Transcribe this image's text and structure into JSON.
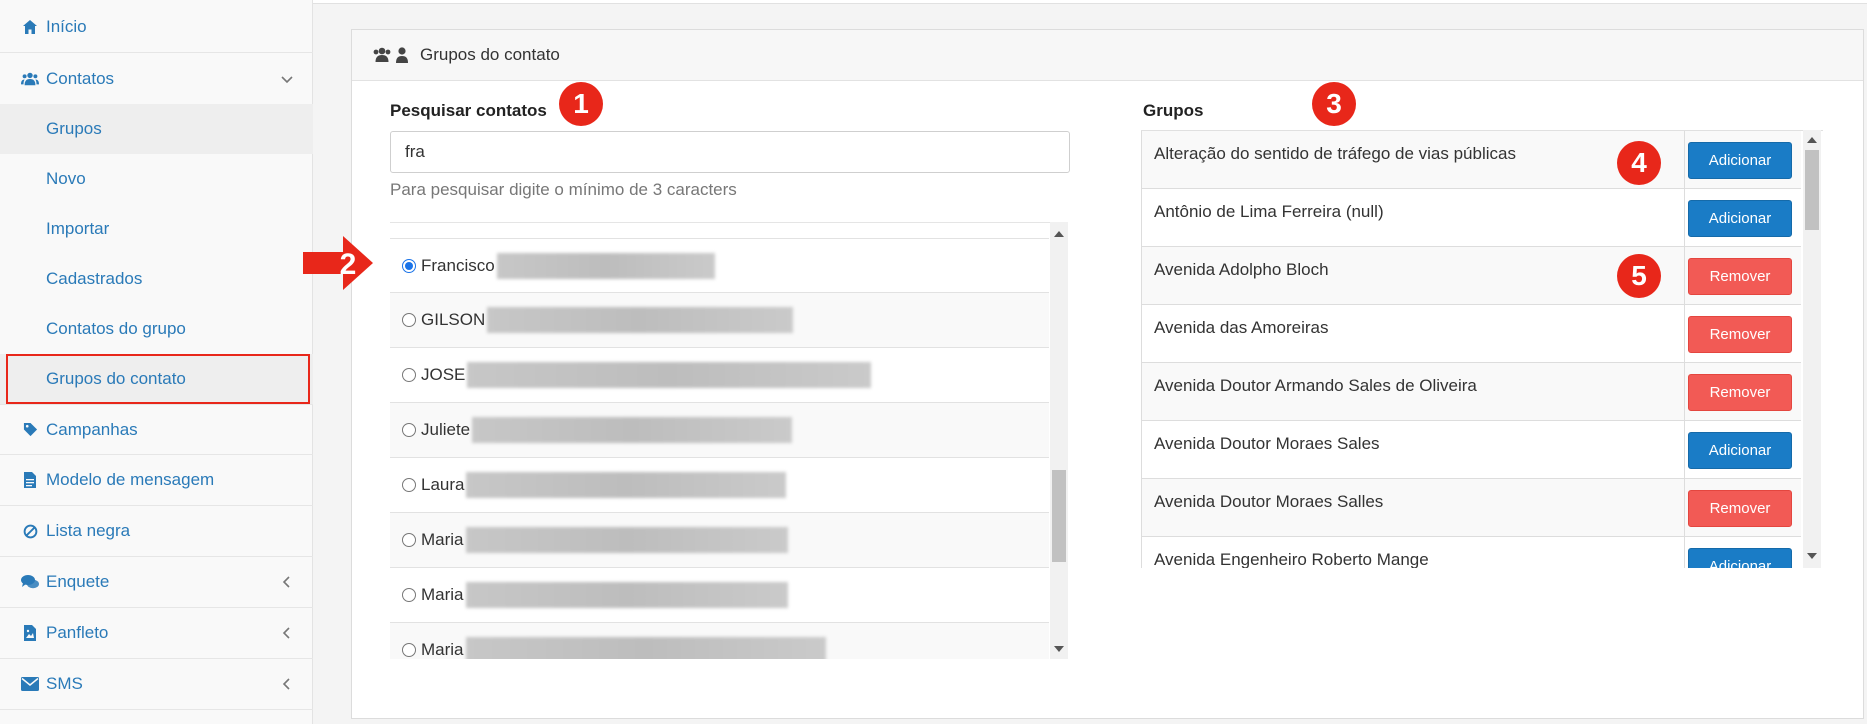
{
  "sidebar": {
    "items": [
      {
        "label": "Início",
        "icon": "home-icon"
      },
      {
        "label": "Contatos",
        "icon": "users-icon"
      },
      {
        "label": "Campanhas",
        "icon": "tag-icon"
      },
      {
        "label": "Modelo de mensagem",
        "icon": "document-icon"
      },
      {
        "label": "Lista negra",
        "icon": "ban-icon"
      },
      {
        "label": "Enquete",
        "icon": "chat-icon"
      },
      {
        "label": "Panfleto",
        "icon": "image-icon"
      },
      {
        "label": "SMS",
        "icon": "envelope-icon"
      }
    ],
    "contatos_sub": [
      {
        "label": "Grupos"
      },
      {
        "label": "Novo"
      },
      {
        "label": "Importar"
      },
      {
        "label": "Cadastrados"
      },
      {
        "label": "Contatos do grupo"
      },
      {
        "label": "Grupos do contato"
      }
    ]
  },
  "panel": {
    "title": "Grupos do contato",
    "search_label": "Pesquisar contatos",
    "search_value": "fra",
    "search_help": "Para pesquisar digite o mínimo de 3 caracters",
    "groups_label": "Grupos"
  },
  "contacts": [
    {
      "name": "Francisco",
      "checked": true
    },
    {
      "name": "GILSON",
      "checked": false
    },
    {
      "name": "JOSE",
      "checked": false
    },
    {
      "name": "Juliete",
      "checked": false
    },
    {
      "name": "Laura",
      "checked": false
    },
    {
      "name": "Maria",
      "checked": false
    },
    {
      "name": "Maria",
      "checked": false
    },
    {
      "name": "Maria",
      "checked": false
    }
  ],
  "groups": [
    {
      "name": "Alteração do sentido de tráfego de vias públicas",
      "action": "Adicionar"
    },
    {
      "name": "Antônio de Lima Ferreira (null)",
      "action": "Adicionar"
    },
    {
      "name": "Avenida Adolpho Bloch",
      "action": "Remover"
    },
    {
      "name": "Avenida das Amoreiras",
      "action": "Remover"
    },
    {
      "name": "Avenida Doutor Armando Sales de Oliveira",
      "action": "Remover"
    },
    {
      "name": "Avenida Doutor Moraes Sales",
      "action": "Adicionar"
    },
    {
      "name": "Avenida Doutor Moraes Salles",
      "action": "Remover"
    },
    {
      "name": "Avenida Engenheiro Roberto Mange",
      "action": "Adicionar"
    }
  ],
  "badges": [
    "1",
    "2",
    "3",
    "4",
    "5"
  ],
  "colors": {
    "link": "#2a7ab8",
    "add": "#1a7cc6",
    "remove": "#f25a55",
    "badge": "#e8271a"
  }
}
